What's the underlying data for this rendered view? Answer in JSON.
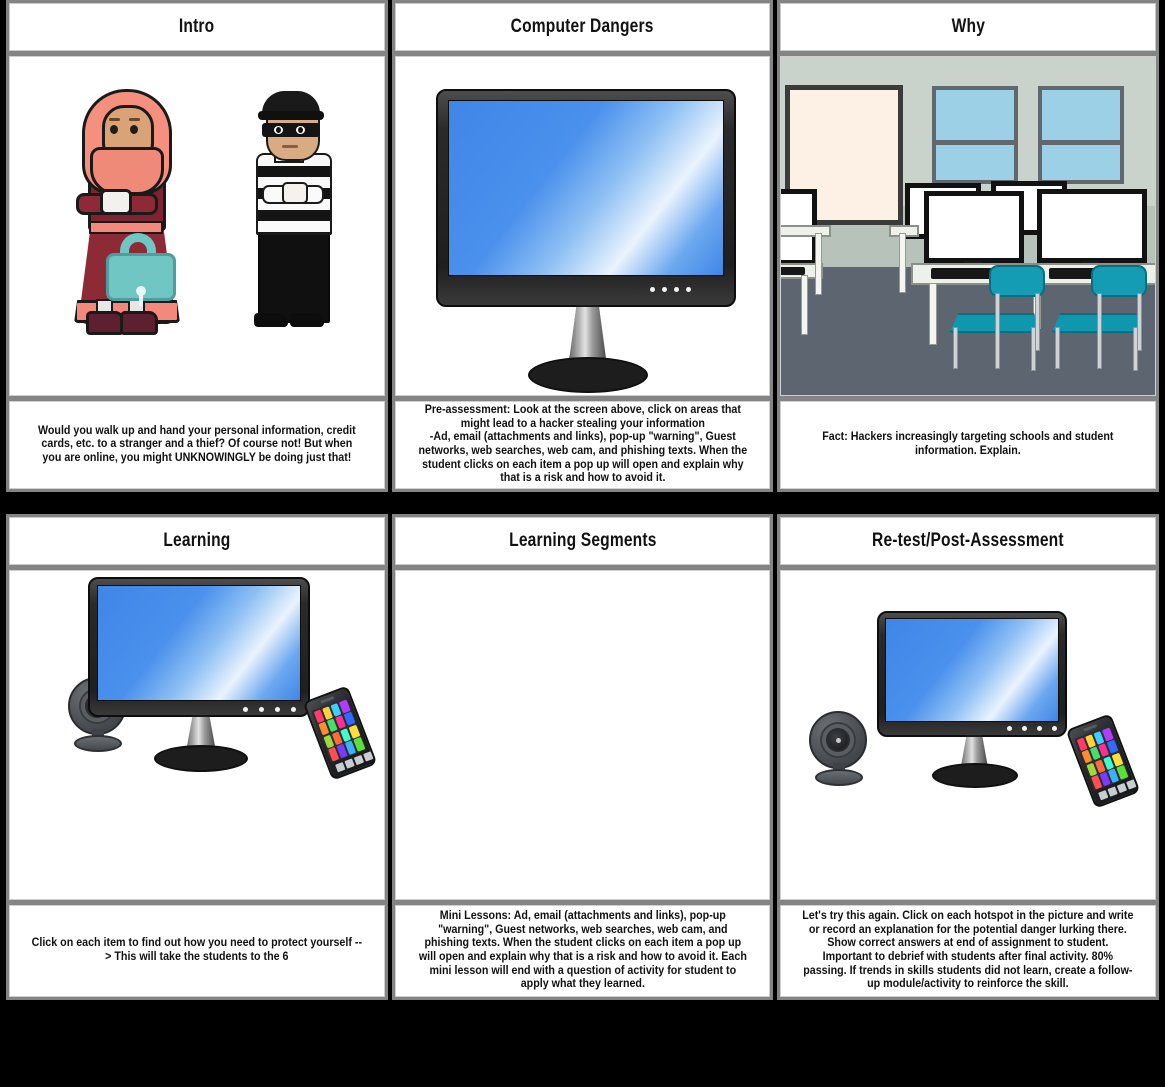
{
  "storyboard": {
    "background_color": "#000000",
    "frame_color": "#848484",
    "cell_background": "#ffffff",
    "rows": [
      {
        "cells": [
          {
            "title": "Intro",
            "scene": "woman-and-thief",
            "caption": "Would you walk up and hand your personal information, credit cards, etc.  to a stranger and  a thief?  Of course not!  But when you are online, you might UNKNOWINGLY be doing just that!"
          },
          {
            "title": "Computer Dangers",
            "scene": "computer-monitor",
            "caption": "Pre-assessment: Look at the screen above, click on areas that might lead to a hacker stealing your information\n-Ad, email (attachments and links), pop-up \"warning\", Guest networks, web searches, web cam, and phishing texts. When the student clicks on each item a pop up will open and explain why that is a risk and how to avoid it."
          },
          {
            "title": "Why",
            "scene": "computer-classroom",
            "caption": "Fact: Hackers increasingly targeting schools and student information. Explain."
          }
        ]
      },
      {
        "cells": [
          {
            "title": "Learning",
            "scene": "devices-webcam-monitor-phone",
            "caption": "Click on each item to find out how you need to protect yourself   --> This will take the students to the 6"
          },
          {
            "title": "Learning Segments",
            "scene": "blank",
            "caption": "Mini Lessons: Ad, email (attachments and links), pop-up \"warning\", Guest networks, web searches, web cam, and phishing texts. When the student clicks on each item a pop up will open and explain why that is a risk and how to avoid it. Each mini lesson will end with a question of activity for student to apply what they learned."
          },
          {
            "title": "Re-test/Post-Assessment",
            "scene": "devices-webcam-monitor-phone",
            "caption": "Let's try this again.  Click on each hotspot in the picture and write or record an explanation for the potential danger lurking there.  Show correct answers at end of assignment to student.   Important to debrief with students after final activity.  80% passing.  If trends in skills students did not learn, create a follow-up module/activity to reinforce the skill."
          }
        ]
      }
    ],
    "colors": {
      "hijab": "#f5907f",
      "dress": "#8e2a36",
      "padlock": "#6fc6c2",
      "thief_stripes": "#141414",
      "monitor_screen_blue": "#4a90ec",
      "classroom_wall": "#c9d3cc",
      "classroom_floor": "#5d6670",
      "chair_teal": "#0f97ae",
      "window_glass": "#9cd0e6"
    }
  }
}
